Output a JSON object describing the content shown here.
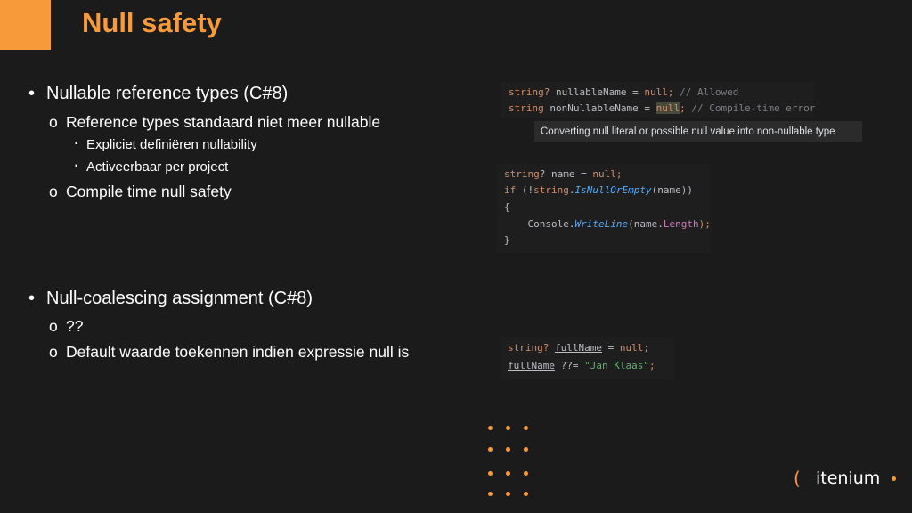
{
  "slide": {
    "title": "Null safety",
    "accent_color": "#f79a3a",
    "background_color": "#1c1b1b"
  },
  "bullets": [
    {
      "level": 1,
      "marker": "•",
      "text": "Nullable reference types (C#8)"
    },
    {
      "level": 2,
      "marker": "o",
      "text": "Reference types standaard niet meer nullable"
    },
    {
      "level": 3,
      "marker": "▪",
      "text": "Expliciet definiëren nullability"
    },
    {
      "level": 3,
      "marker": "▪",
      "text": "Activeerbaar per project"
    },
    {
      "level": 2,
      "marker": "o",
      "text": "Compile time null safety"
    },
    {
      "level": 1,
      "marker": "•",
      "text": "Null-coalescing assignment (C#8)"
    },
    {
      "level": 2,
      "marker": "o",
      "text": "??"
    },
    {
      "level": 2,
      "marker": "o",
      "text": "Default waarde toekennen indien expressie null is"
    }
  ],
  "code": {
    "snippet1": {
      "line1": {
        "type": "string",
        "q": "?",
        "name": " nullableName = ",
        "null": "null",
        "semi": ";",
        "comment": " // Allowed"
      },
      "line2": {
        "type": "string",
        "name": " nonNullableName = ",
        "null": "null",
        "semi": ";",
        "comment": " // Compile-time error"
      },
      "tooltip": "Converting null literal or possible null value into non-nullable type"
    },
    "snippet2": {
      "line1": {
        "type": "string",
        "rest": "? name = ",
        "null": "null",
        "semi": ";"
      },
      "line2": {
        "kw_if": "if",
        "open": " (!",
        "type": "string",
        "dot": ".",
        "method": "IsNullOrEmpty",
        "close": "(name))"
      },
      "line3": "{",
      "line4": {
        "indent": "    ",
        "cls": "Console",
        "dot": ".",
        "method": "WriteLine",
        "open": "(name.",
        "prop": "Length",
        "close": ");"
      },
      "line5": "}"
    },
    "snippet3": {
      "line1": {
        "type": "string",
        "q": "? ",
        "var": "fullName",
        "eq": " = ",
        "null": "null",
        "semi": ";"
      },
      "line2": {
        "var": "fullName",
        "op": " ??= ",
        "str": "\"Jan Klaas\"",
        "semi": ";"
      }
    }
  },
  "logo": {
    "mark": "(",
    "text": "itenium"
  }
}
